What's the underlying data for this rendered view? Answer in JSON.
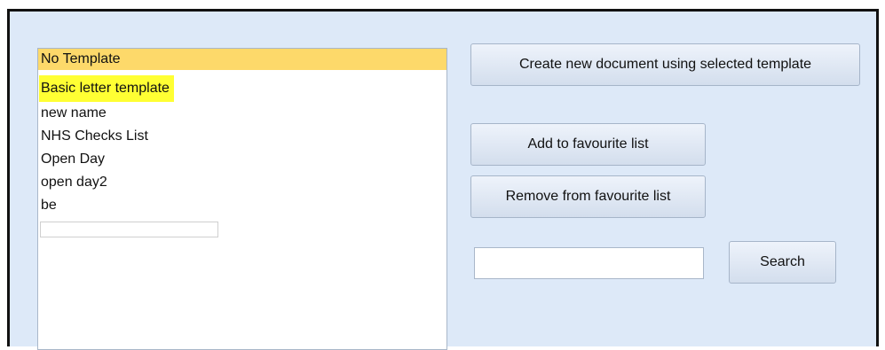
{
  "templates": {
    "items": [
      "No Template",
      "Basic letter template",
      "new name",
      "NHS Checks List",
      "Open Day",
      "open day2",
      "be"
    ],
    "selected_index": 0,
    "highlighted_index": 1
  },
  "actions": {
    "create_label": "Create new document using selected template",
    "add_favourite_label": "Add to favourite list",
    "remove_favourite_label": "Remove from favourite list",
    "search_label": "Search",
    "search_value": ""
  }
}
